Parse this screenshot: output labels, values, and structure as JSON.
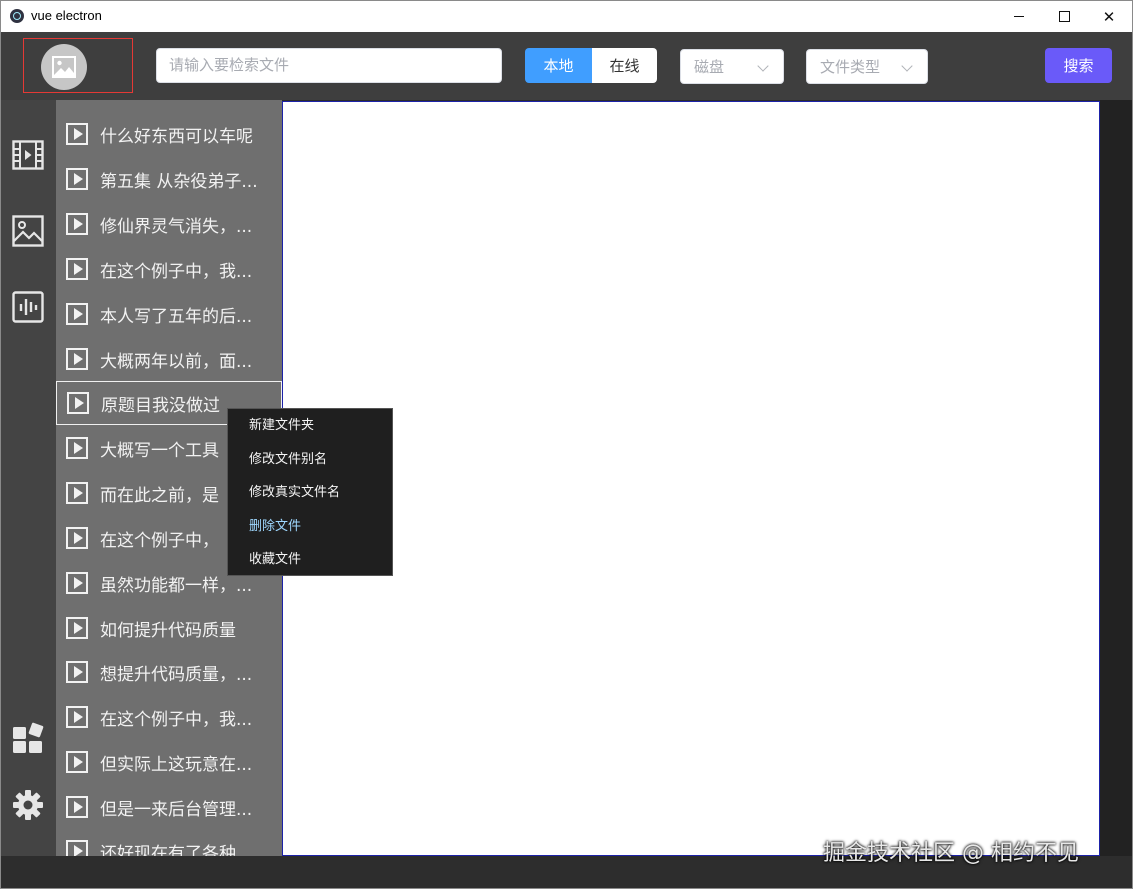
{
  "window": {
    "title": "vue electron",
    "controls": {
      "minimize": "",
      "maximize": "",
      "close": "✕"
    }
  },
  "header": {
    "search": {
      "placeholder": "请输入要检索文件",
      "value": ""
    },
    "source_toggle": {
      "options": [
        "本地",
        "在线"
      ],
      "selected": "本地"
    },
    "disk_select": {
      "placeholder": "磁盘"
    },
    "type_select": {
      "placeholder": "文件类型"
    },
    "search_button": "搜索"
  },
  "sidebar": {
    "icons": [
      "video-icon",
      "image-icon",
      "audio-icon",
      "apps-icon",
      "settings-icon"
    ]
  },
  "file_list": {
    "items": [
      "什么好东西可以车呢",
      "第五集 从杂役弟子...",
      "修仙界灵气消失，...",
      "在这个例子中，我...",
      "本人写了五年的后...",
      "大概两年以前，面...",
      "原题目我没做过",
      "大概写一个工具",
      "而在此之前，是",
      "在这个例子中，",
      "虽然功能都一样，...",
      "如何提升代码质量",
      "想提升代码质量，...",
      "在这个例子中，我...",
      "但实际上这玩意在...",
      "但是一来后台管理...",
      "还好现在有了各种"
    ],
    "selected_index": 6
  },
  "context_menu": {
    "items": [
      "新建文件夹",
      "修改文件别名",
      "修改真实文件名",
      "删除文件",
      "收藏文件"
    ]
  },
  "watermark": "掘金技术社区 @ 相约不见",
  "colors": {
    "accent": "#409eff",
    "search_button": "#6a5af9",
    "file_list_bg": "#6f6f6f",
    "icon_bar_bg": "#444444"
  }
}
